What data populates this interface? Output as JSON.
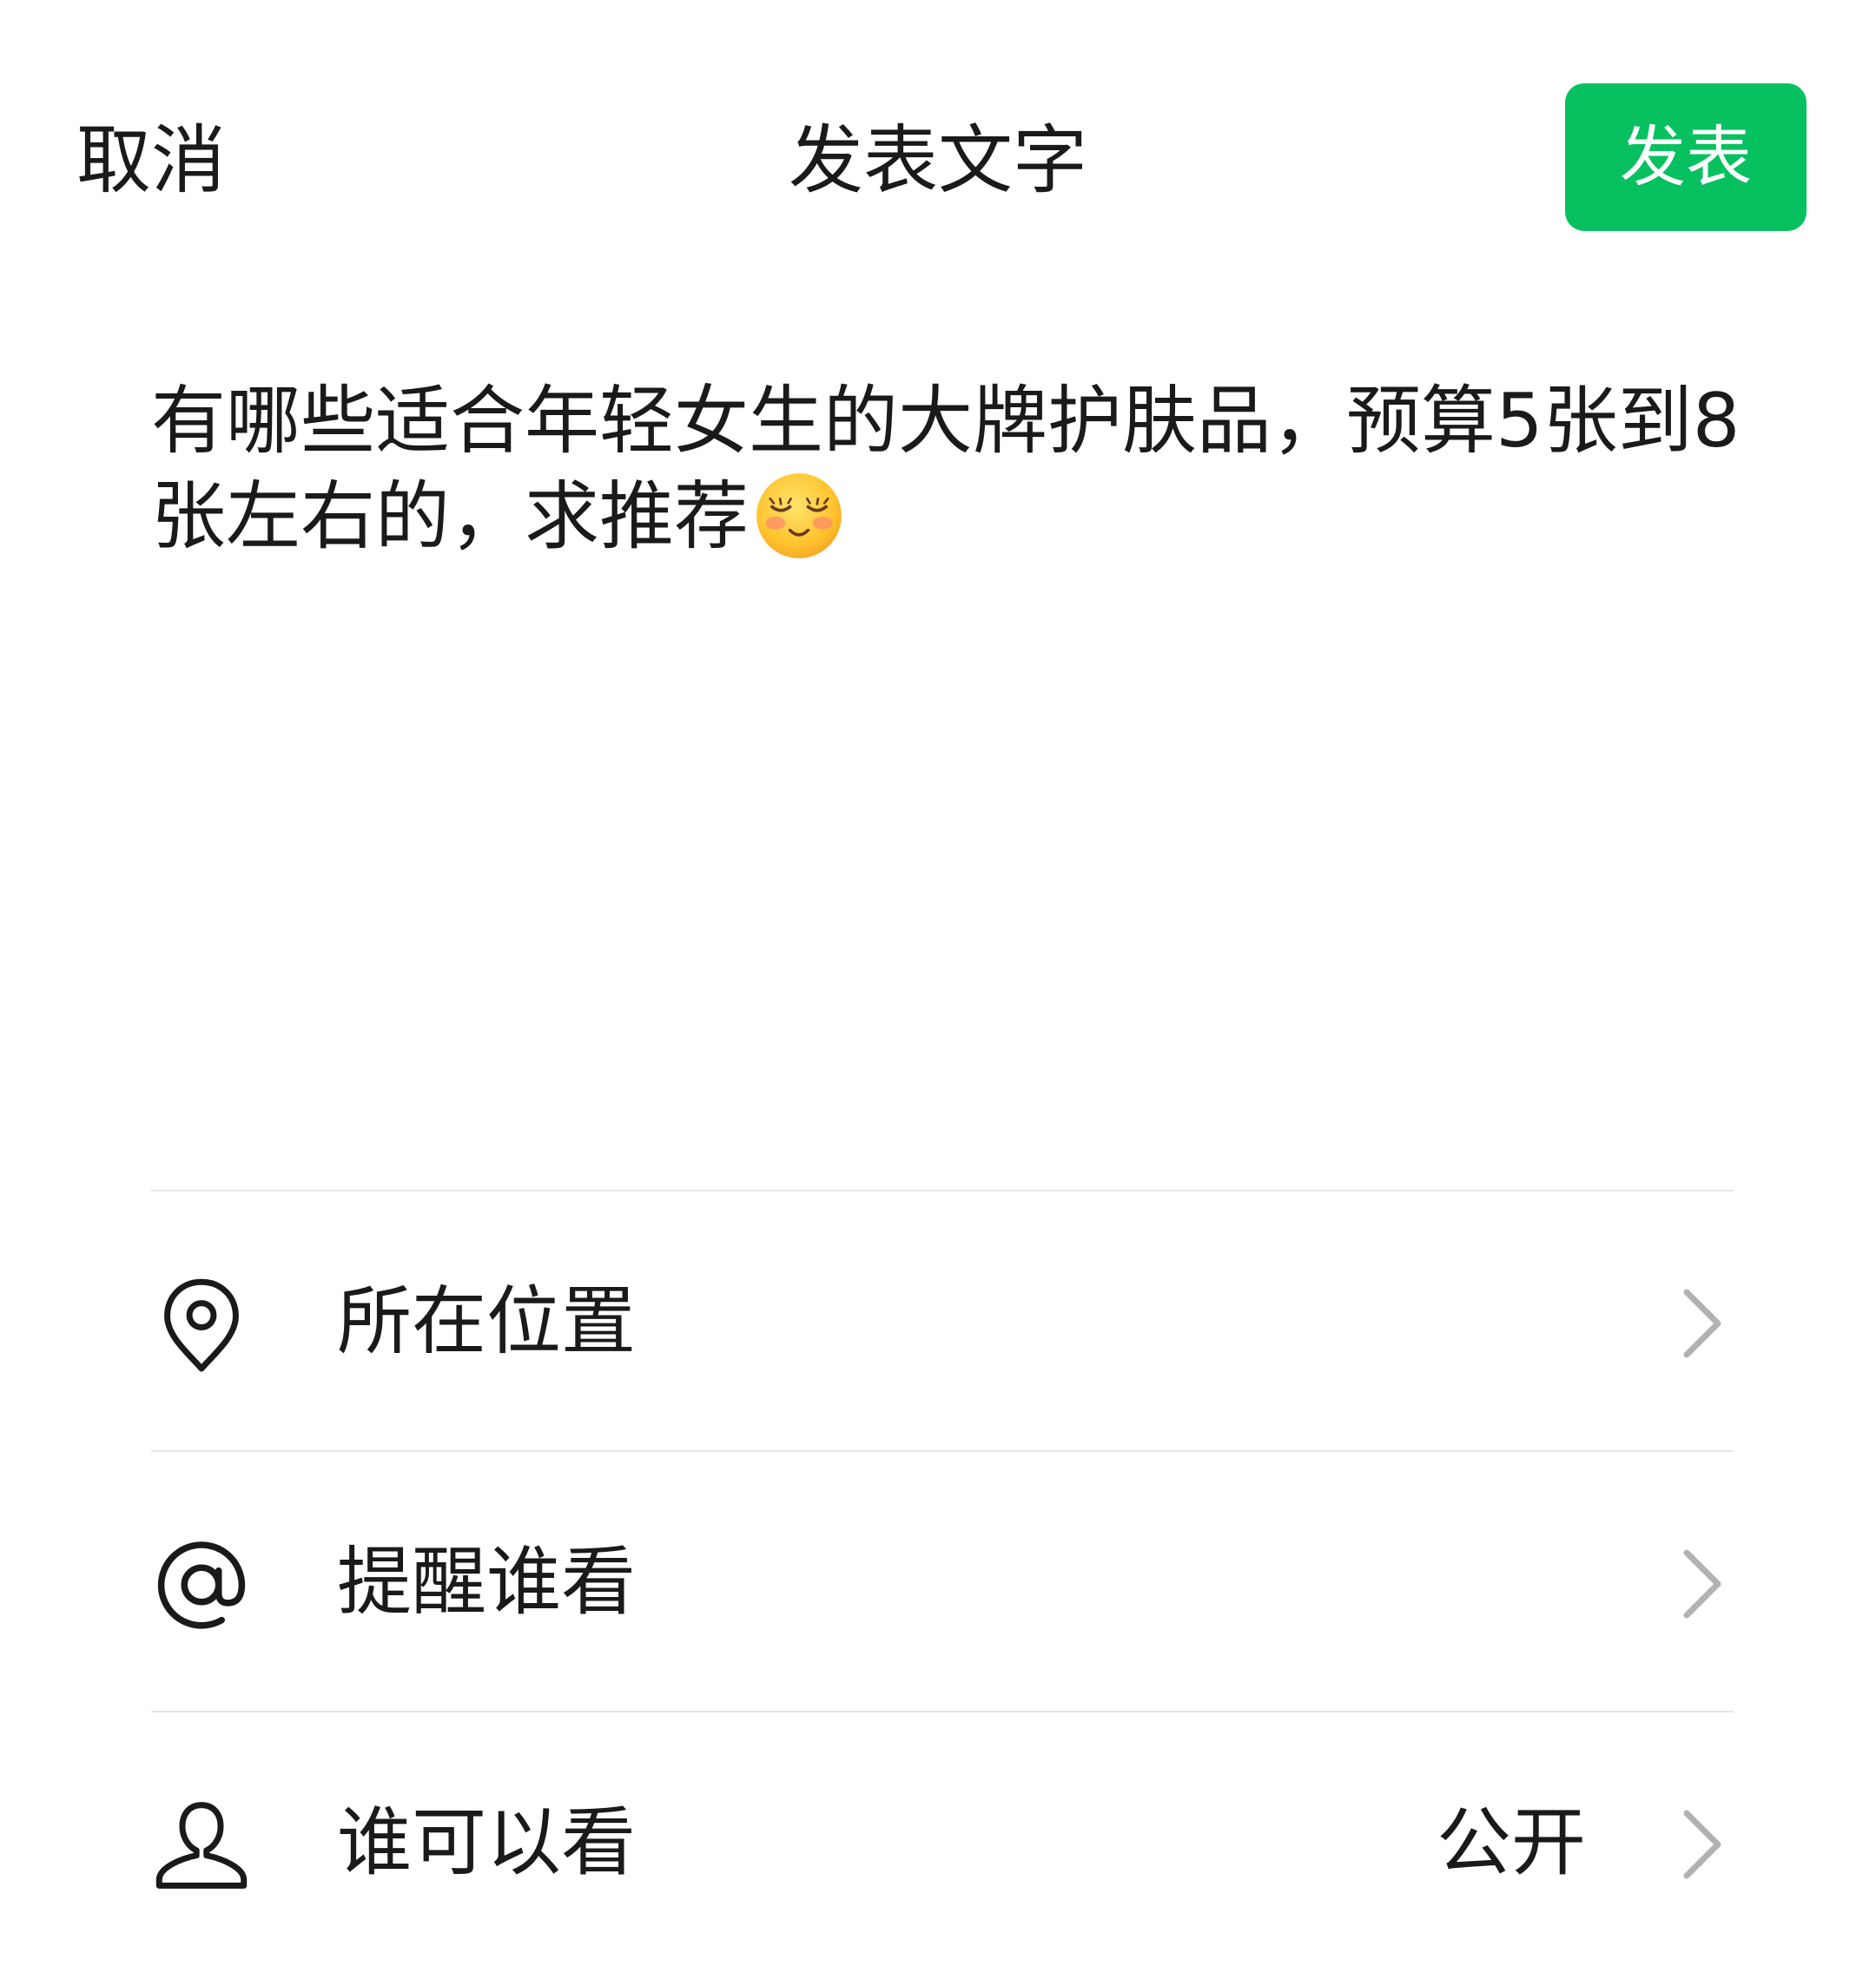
{
  "header": {
    "cancel_label": "取消",
    "title": "发表文字",
    "publish_label": "发表"
  },
  "compose": {
    "text": "有哪些适合年轻女生的大牌护肤品，预算5张到8张左右的，求推荐",
    "emoji": "smiling-face-with-closed-eyes-blush-icon"
  },
  "options": [
    {
      "icon": "location-pin-icon",
      "label": "所在位置",
      "value": ""
    },
    {
      "icon": "at-sign-icon",
      "label": "提醒谁看",
      "value": ""
    },
    {
      "icon": "person-icon",
      "label": "谁可以看",
      "value": "公开"
    }
  ],
  "colors": {
    "accent": "#07c160",
    "text": "#1a1a1a",
    "divider": "#e6e6e6",
    "chevron": "#b2b2b2"
  }
}
